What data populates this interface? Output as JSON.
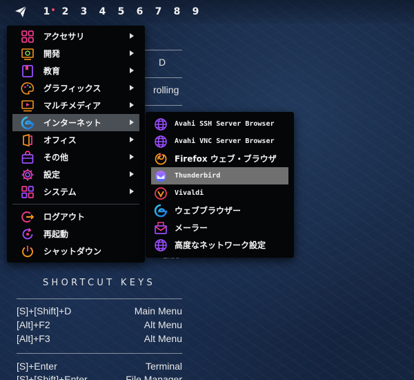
{
  "panel": {
    "workspaces": [
      "1",
      "2",
      "3",
      "4",
      "5",
      "6",
      "7",
      "8",
      "9"
    ],
    "active_workspace": "1"
  },
  "desktop": {
    "conky": {
      "fragment_d": "D",
      "release_text": "rolling",
      "fragment_num": "2.89",
      "shortcut_title": "SHORTCUT KEYS",
      "shortcuts": [
        {
          "keys": "[S]+[Shift]+D",
          "action": "Main Menu"
        },
        {
          "keys": "[Alt]+F2",
          "action": "Alt Menu"
        },
        {
          "keys": "[Alt]+F3",
          "action": "Alt Menu"
        },
        {
          "keys": "[S]+Enter",
          "action": "Terminal"
        },
        {
          "keys": "[S]+[Shift]+Enter",
          "action": "File Manager"
        }
      ]
    }
  },
  "main_menu": {
    "items": [
      {
        "label": "アクセサリ",
        "icon": "accessories-icon",
        "submenu": true
      },
      {
        "label": "開発",
        "icon": "development-icon",
        "submenu": true
      },
      {
        "label": "教育",
        "icon": "education-icon",
        "submenu": true
      },
      {
        "label": "グラフィックス",
        "icon": "graphics-icon",
        "submenu": true
      },
      {
        "label": "マルチメディア",
        "icon": "multimedia-icon",
        "submenu": true
      },
      {
        "label": "インターネット",
        "icon": "internet-icon",
        "submenu": true,
        "highlighted": true
      },
      {
        "label": "オフィス",
        "icon": "office-icon",
        "submenu": true
      },
      {
        "label": "その他",
        "icon": "other-icon",
        "submenu": true
      },
      {
        "label": "設定",
        "icon": "settings-icon",
        "submenu": true
      },
      {
        "label": "システム",
        "icon": "system-icon",
        "submenu": true
      }
    ],
    "session_items": [
      {
        "label": "ログアウト",
        "icon": "logout-icon"
      },
      {
        "label": "再起動",
        "icon": "reboot-icon"
      },
      {
        "label": "シャットダウン",
        "icon": "shutdown-icon"
      }
    ]
  },
  "internet_submenu": {
    "items": [
      {
        "label": "Avahi SSH Server Browser",
        "icon": "globe-icon"
      },
      {
        "label": "Avahi VNC Server Browser",
        "icon": "globe-icon"
      },
      {
        "label": "Firefox ウェブ・ブラウザ",
        "icon": "firefox-icon"
      },
      {
        "label": "Thunderbird",
        "icon": "thunderbird-icon",
        "highlighted": true
      },
      {
        "label": "Vivaldi",
        "icon": "vivaldi-icon"
      },
      {
        "label": "ウェブブラウザー",
        "icon": "web-browser-icon"
      },
      {
        "label": "メーラー",
        "icon": "mailer-icon"
      },
      {
        "label": "高度なネットワーク設定",
        "icon": "globe-icon"
      }
    ]
  },
  "colors": {
    "icon_pink": "#f03a8c",
    "icon_orange": "#f7941d",
    "icon_purple": "#9b4dff",
    "highlight_main": "#4a4f55",
    "highlight_sub": "#707070"
  }
}
